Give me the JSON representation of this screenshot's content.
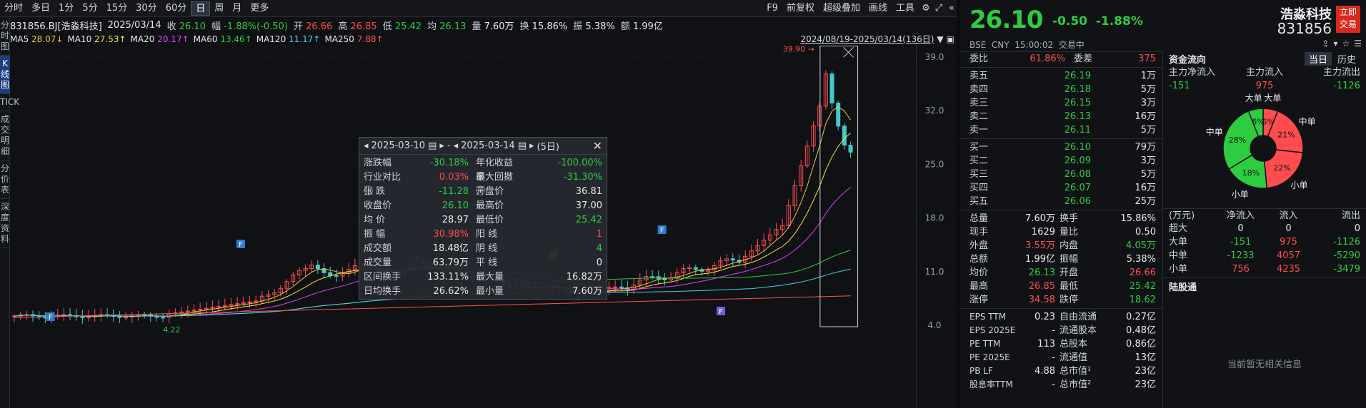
{
  "topbar": {
    "periods": [
      "分时",
      "多日",
      "1分",
      "5分",
      "15分",
      "30分",
      "60分",
      "日",
      "周",
      "月",
      "更多"
    ],
    "active_period": "日",
    "tools": [
      "F9",
      "前复权",
      "超级叠加",
      "画线",
      "工具"
    ]
  },
  "side_tabs": [
    "分时图",
    "K线图",
    "TICK",
    "成交明细",
    "分价表",
    "深度资料"
  ],
  "info": {
    "code_name": "831856.BJ[浩淼科技]",
    "date": "2025/03/14",
    "close_label": "收",
    "close": "26.10",
    "amp_label": "幅",
    "amp": "-1.88%(-0.50)",
    "open_label": "开",
    "open": "26.66",
    "high_label": "高",
    "high": "26.85",
    "low_label": "低",
    "low": "25.42",
    "avg_label": "均",
    "avg": "26.13",
    "vol_label": "量",
    "vol": "7.60万",
    "turn_label": "换",
    "turn": "15.86%",
    "swing_label": "振",
    "swing": "5.38%",
    "amt_label": "额",
    "amt": "1.99亿",
    "range": "2024/08/19-2025/03/14(136日)"
  },
  "ma": [
    {
      "label": "MA5",
      "value": "28.07↓",
      "color": "#f5c242"
    },
    {
      "label": "MA10",
      "value": "27.53↑",
      "color": "#f5e642"
    },
    {
      "label": "MA20",
      "value": "20.17↑",
      "color": "#e040fb"
    },
    {
      "label": "MA60",
      "value": "13.46↑",
      "color": "#2ecc40"
    },
    {
      "label": "MA120",
      "value": "11.17↑",
      "color": "#4dd0e1"
    },
    {
      "label": "MA250",
      "value": "7.88↑",
      "color": "#ff5252"
    }
  ],
  "chart": {
    "y_ticks": [
      "39.0",
      "32.0",
      "25.0",
      "18.0",
      "11.0",
      "4.0"
    ],
    "high_mark": "39.90",
    "low_mark": "4.22",
    "events": [
      {
        "t": "F",
        "color": "#2a7fd4",
        "pos": 0.04
      },
      {
        "t": "F",
        "color": "#2a7fd4",
        "pos": 0.25
      },
      {
        "t": "E",
        "color": "#d4a72a",
        "pos": 0.595
      },
      {
        "t": "F",
        "color": "#2a7fd4",
        "pos": 0.715
      },
      {
        "t": "F",
        "color": "#7a5ad4",
        "pos": 0.78
      }
    ]
  },
  "popup": {
    "start": "2025-03-10",
    "end": "2025-03-14",
    "days": "(5日)",
    "rows": [
      [
        "涨跌幅",
        "-30.18%",
        "年化收益率",
        "-100.00%"
      ],
      [
        "行业对比 ⓘ",
        "0.03%",
        "最大回撤 ⓘ",
        "-31.30%"
      ],
      [
        "张 跌",
        "-11.28",
        "开盘价",
        "36.81"
      ],
      [
        "收盘价",
        "26.10",
        "最高价",
        "37.00"
      ],
      [
        "均 价",
        "28.97",
        "最低价",
        "25.42"
      ],
      [
        "振 幅",
        "30.98%",
        "阳 线",
        "1"
      ],
      [
        "成交额",
        "18.48亿",
        "阴 线",
        "4"
      ],
      [
        "成交量",
        "63.79万",
        "平 线",
        "0"
      ],
      [
        "区间换手",
        "133.11%",
        "最大量",
        "16.82万"
      ],
      [
        "日均换手",
        "26.62%",
        "最小量",
        "7.60万"
      ]
    ],
    "colors": [
      [
        "dn",
        "dn"
      ],
      [
        "up",
        "dn"
      ],
      [
        "dn",
        "wh"
      ],
      [
        "dn",
        "wh"
      ],
      [
        "wh",
        "dn"
      ],
      [
        "up",
        "up"
      ],
      [
        "wh",
        "dn"
      ],
      [
        "wh",
        "wh"
      ],
      [
        "wh",
        "wh"
      ],
      [
        "wh",
        "wh"
      ]
    ]
  },
  "quote": {
    "price": "26.10",
    "chg": "-0.50",
    "pct": "-1.88%",
    "exchange": "BSE",
    "currency": "CNY",
    "time": "15:00:02",
    "status": "交易中",
    "name": "浩淼科技",
    "code": "831856",
    "badge": "立即交易",
    "weibi_label": "委比",
    "weibi": "61.86%",
    "weicha_label": "委差",
    "weicha": "375",
    "asks": [
      [
        "卖五",
        "26.19",
        "1万"
      ],
      [
        "卖四",
        "26.18",
        "5万"
      ],
      [
        "卖三",
        "26.15",
        "3万"
      ],
      [
        "卖二",
        "26.13",
        "16万"
      ],
      [
        "卖一",
        "26.11",
        "5万"
      ]
    ],
    "bids": [
      [
        "买一",
        "26.10",
        "79万"
      ],
      [
        "买二",
        "26.09",
        "3万"
      ],
      [
        "买三",
        "26.08",
        "5万"
      ],
      [
        "买四",
        "26.07",
        "16万"
      ],
      [
        "买五",
        "26.06",
        "25万"
      ]
    ],
    "stats": [
      [
        "总量",
        "7.60万",
        "换手",
        "15.86%"
      ],
      [
        "现手",
        "1629",
        "量比",
        "0.50"
      ],
      [
        "外盘",
        "3.55万",
        "内盘",
        "4.05万"
      ],
      [
        "总额",
        "1.99亿",
        "振幅",
        "5.38%"
      ],
      [
        "均价",
        "26.13",
        "开盘",
        "26.66"
      ],
      [
        "最高",
        "26.85",
        "最低",
        "25.42"
      ],
      [
        "涨停",
        "34.58",
        "跌停",
        "18.62"
      ]
    ],
    "stat_colors": [
      [
        "wh",
        "wh"
      ],
      [
        "wh",
        "wh"
      ],
      [
        "up",
        "dn"
      ],
      [
        "wh",
        "wh"
      ],
      [
        "dn",
        "up"
      ],
      [
        "up",
        "dn"
      ],
      [
        "up",
        "dn"
      ]
    ],
    "fin": [
      [
        "EPS TTM",
        "0.23",
        "自由流通",
        "0.27亿"
      ],
      [
        "EPS 2025E",
        "-",
        "流通股本",
        "0.48亿"
      ],
      [
        "PE TTM",
        "113",
        "总股本",
        "0.86亿"
      ],
      [
        "PE 2025E",
        "-",
        "流通值",
        "13亿"
      ],
      [
        "PB LF",
        "4.88",
        "总市值¹",
        "23亿"
      ],
      [
        "股息率TTM",
        "-",
        "总市值²",
        "23亿"
      ]
    ]
  },
  "fund": {
    "title": "资金流向",
    "tab_today": "当日",
    "tab_hist": "历史",
    "net_label": "主力净流入",
    "in_label": "主力流入",
    "out_label": "主力流出",
    "net": "-151",
    "inflow": "975",
    "outflow": "-1126",
    "pie": [
      {
        "label": "大单",
        "pct": "6%",
        "v": 6,
        "color": "#ff4d4f"
      },
      {
        "label": "中单",
        "pct": "21%",
        "v": 21,
        "color": "#ff4d4f"
      },
      {
        "label": "小单",
        "pct": "22%",
        "v": 22,
        "color": "#ff4d4f"
      },
      {
        "label": "小单",
        "pct": "18%",
        "v": 18,
        "color": "#2ecc40"
      },
      {
        "label": "中单",
        "pct": "28%",
        "v": 28,
        "color": "#2ecc40"
      },
      {
        "label": "大单",
        "pct": "6%",
        "v": 6,
        "color": "#2ecc40"
      }
    ],
    "table_head": [
      "(万元)",
      "净流入",
      "流入",
      "流出"
    ],
    "table": [
      [
        "超大",
        "0",
        "0",
        "0"
      ],
      [
        "大单",
        "-151",
        "975",
        "-1126"
      ],
      [
        "中单",
        "-1233",
        "4057",
        "-5290"
      ],
      [
        "小单",
        "756",
        "4235",
        "-3479"
      ]
    ],
    "lgt_title": "陆股通",
    "lgt_empty": "当前暂无相关信息"
  }
}
